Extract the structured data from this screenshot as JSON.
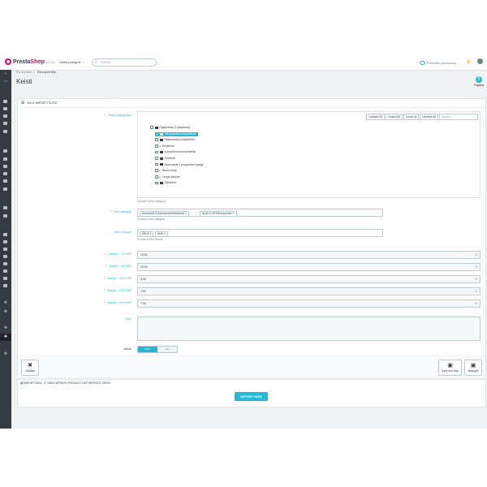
{
  "topbar": {
    "logo_pre": "Presta",
    "logo_post": "Shop",
    "version": "1.7.6.x",
    "quick_access": "Greita prieiga ▾",
    "search_placeholder": "Paieška",
    "store_link": "Peržiūrėti parduotuvę",
    "brand_color": "#df0067",
    "accent_color": "#25b9d7"
  },
  "breadcrumb": [
    "Fix Imports",
    "Ekomport filer"
  ],
  "page_title": "Keisti",
  "help_label": "Pagalba",
  "panel": {
    "title": "Eiko import filter",
    "tree_label": "Prekių kategorijos",
    "tree_toolbar": [
      "Collapse All",
      "Expand All",
      "Check All",
      "Uncheck All"
    ],
    "tree_search": "paieška...",
    "tree_items": [
      {
        "label": "Pagrindinis (1 pažymėta)",
        "type": "folder",
        "level": 0,
        "checked": false
      },
      {
        "label": "Nešiojamieji kompiuteriai",
        "type": "selected",
        "level": 1,
        "checked": true
      },
      {
        "label": "Stacionarūs kompiuteriai",
        "type": "folder",
        "level": 1,
        "checked": false
      },
      {
        "label": "Monitoriai",
        "type": "leaf",
        "level": 1,
        "checked": false
      },
      {
        "label": "Kompiuterių komponentai",
        "type": "folder",
        "level": 1,
        "checked": false
      },
      {
        "label": "Telefonai",
        "type": "folder",
        "level": 1,
        "checked": false
      },
      {
        "label": "Aksesuarai ir programinė įranga",
        "type": "folder",
        "level": 1,
        "checked": false
      },
      {
        "label": "Black friday",
        "type": "leaf",
        "level": 1,
        "checked": false
      },
      {
        "label": "Lengvi akcijos",
        "type": "leaf",
        "level": 1,
        "checked": false
      },
      {
        "label": "Skirtamai",
        "type": "folder",
        "level": 1,
        "checked": false
      }
    ],
    "tree_hint": "Choose a shop category",
    "eiko_cat_label": "Eiko category",
    "eiko_cat_tags": [
      "Notebooks & Accessories/Notebooks",
      "Audio & HiFi/Microphones"
    ],
    "eiko_cat_hint": "Choose a eiko category",
    "eiko_vendor_label": "Eiko Vendors",
    "eiko_vendor_tags": [
      "ASUS",
      "AMD"
    ],
    "eiko_vendor_hint": "Choose a Eiko Vendor",
    "margins": [
      {
        "label": "Margin < 10 EUR",
        "value": "15.00"
      },
      {
        "label": "Margin < 50 EUR",
        "value": "10.00"
      },
      {
        "label": "Margin < 100 EUR",
        "value": "8.00"
      },
      {
        "label": "Margin < 200 EUR",
        "value": "7.00"
      },
      {
        "label": "Margin < 500 EUR",
        "value": "7.00"
      }
    ],
    "percent_sign": "%",
    "note_label": "Note",
    "active_label": "Active",
    "switch_on": "TAIP",
    "switch_off": "NE",
    "cancel_label": "Atšaukti",
    "save_stay_label": "Save and Stay",
    "save_label": "Išsaugoti"
  },
  "import_panel": {
    "title": "Import now - If need update product list without cron",
    "button": "IMPORT NOW"
  }
}
